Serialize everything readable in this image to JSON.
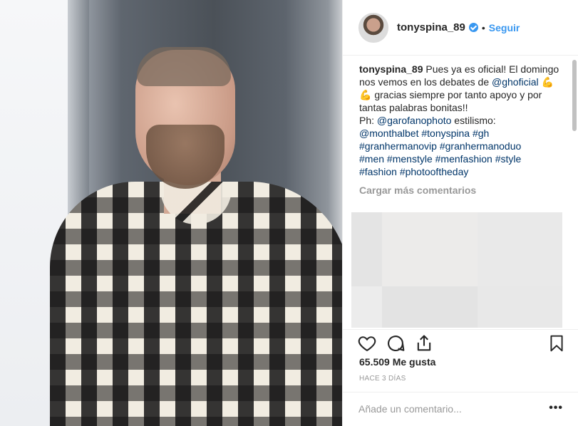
{
  "post": {
    "author": {
      "handle": "tonyspina_89",
      "follow_label": "Seguir",
      "separator": "•"
    },
    "caption": {
      "user": "tonyspina_89",
      "text1": " Pues ya es oficial! El domingo nos vemos en los debates de ",
      "mention_gh": "@ghoficial",
      "emoji": " 💪💪 ",
      "text2": "gracias siempre por tanto apoyo y por tantas palabras bonitas!!",
      "ph_prefix": "Ph: ",
      "mention_photo": "@garofanophoto",
      "stylist_label": " estilismo:",
      "mention_stylist": "@monthalbet",
      "tags": [
        "#tonyspina",
        "#gh",
        "#granhermanovip",
        "#granhermanoduo",
        "#men",
        "#menstyle",
        "#menfashion",
        "#style",
        "#fashion",
        "#photooftheday"
      ]
    },
    "load_more_label": "Cargar más comentarios",
    "likes_text": "65.509 Me gusta",
    "time_ago": "HACE 3 DÍAS",
    "comment_placeholder": "Añade un comentario...",
    "more_label": "•••"
  },
  "icons": {
    "like": "heart-icon",
    "comment": "comment-icon",
    "share": "share-icon",
    "save": "bookmark-icon",
    "verified": "verified-badge-icon"
  },
  "colors": {
    "link": "#003569",
    "follow": "#3897f0",
    "muted": "#999999"
  }
}
